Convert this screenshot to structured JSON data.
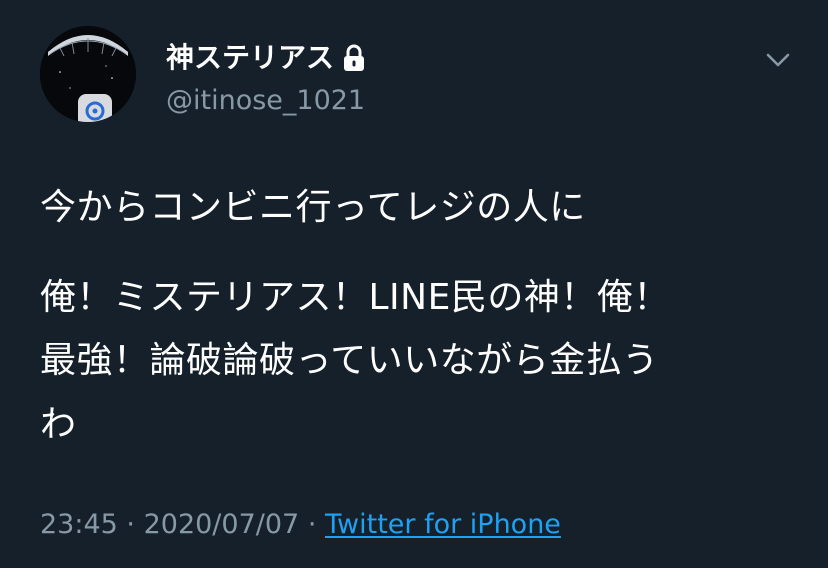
{
  "user": {
    "display_name": "神ステリアス",
    "handle": "@itinose_1021",
    "protected": true
  },
  "tweet": {
    "lines": [
      "今からコンビニ行ってレジの人に",
      "俺！ミステリアス！LINE民の神！俺！",
      "最強！論破論破っていいながら金払う",
      "わ"
    ]
  },
  "meta": {
    "time": "23:45",
    "separator": "·",
    "date": "2020/07/07",
    "source": "Twitter for iPhone"
  },
  "colors": {
    "background": "#15202b",
    "text": "#ffffff",
    "secondary": "#8899a6",
    "link": "#1da1f2"
  },
  "icons": {
    "lock": "lock-icon",
    "caret": "chevron-down-icon"
  }
}
